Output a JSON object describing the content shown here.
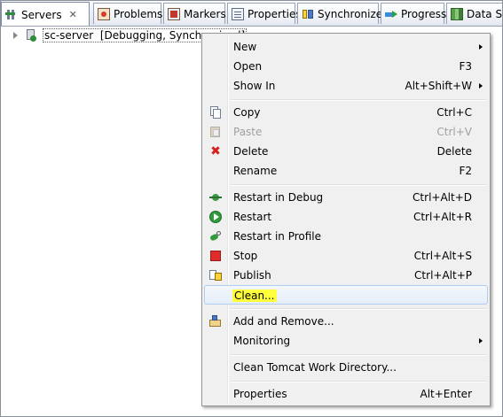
{
  "tabs": [
    {
      "label": "Servers",
      "icon": "servers-icon",
      "active": true,
      "close": "✕"
    },
    {
      "label": "Problems",
      "icon": "problems-icon"
    },
    {
      "label": "Markers",
      "icon": "markers-icon"
    },
    {
      "label": "Properties",
      "icon": "properties-icon"
    },
    {
      "label": "Synchronize",
      "icon": "synchronize-icon"
    },
    {
      "label": "Progress",
      "icon": "progress-icon"
    },
    {
      "label": "Data So",
      "icon": "data-source-icon"
    }
  ],
  "tree": {
    "server_name": "sc-server",
    "server_state": "[Debugging, Synchronized]"
  },
  "menu": {
    "items": [
      {
        "label": "New",
        "accel": "",
        "submenu": true,
        "icon": ""
      },
      {
        "label": "Open",
        "accel": "F3",
        "icon": ""
      },
      {
        "label": "Show In",
        "accel": "Alt+Shift+W",
        "submenu": true,
        "icon": ""
      },
      {
        "label": "Copy",
        "accel": "Ctrl+C",
        "icon": "copy-icon"
      },
      {
        "label": "Paste",
        "accel": "Ctrl+V",
        "icon": "paste-icon",
        "disabled": true
      },
      {
        "label": "Delete",
        "accel": "Delete",
        "icon": "delete-icon"
      },
      {
        "label": "Rename",
        "accel": "F2",
        "icon": ""
      },
      {
        "label": "Restart in Debug",
        "accel": "Ctrl+Alt+D",
        "icon": "debug-icon"
      },
      {
        "label": "Restart",
        "accel": "Ctrl+Alt+R",
        "icon": "restart-icon"
      },
      {
        "label": "Restart in Profile",
        "accel": "",
        "icon": "profile-icon"
      },
      {
        "label": "Stop",
        "accel": "Ctrl+Alt+S",
        "icon": "stop-icon"
      },
      {
        "label": "Publish",
        "accel": "Ctrl+Alt+P",
        "icon": "publish-icon"
      },
      {
        "label": "Clean...",
        "accel": "",
        "icon": "",
        "hovered": true,
        "highlight": "#ffff3c"
      },
      {
        "label": "Add and Remove...",
        "accel": "",
        "icon": "add-remove-icon"
      },
      {
        "label": "Monitoring",
        "accel": "",
        "submenu": true,
        "icon": ""
      },
      {
        "label": "Clean Tomcat Work Directory...",
        "accel": "",
        "icon": ""
      },
      {
        "label": "Properties",
        "accel": "Alt+Enter",
        "icon": ""
      }
    ]
  },
  "colors": {
    "menu_background": "#f0f0f0",
    "hover_border": "#aecdf0",
    "highlight": "#ffff3c",
    "delete_red": "#d21f1f",
    "stop_red": "#e02b2b",
    "run_green": "#2f9b3a"
  }
}
